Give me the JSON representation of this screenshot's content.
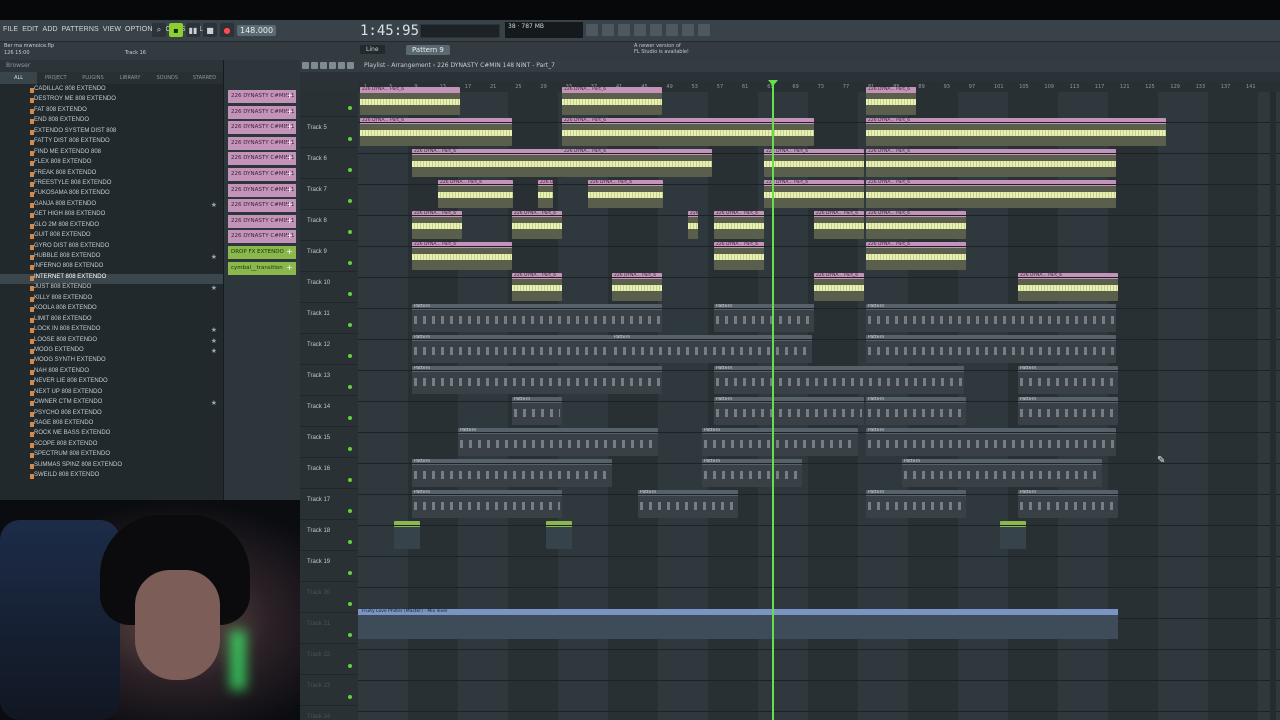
{
  "menu": [
    "FILE",
    "EDIT",
    "ADD",
    "PATTERNS",
    "VIEW",
    "OPTIONS",
    "TOOLS",
    "HELP"
  ],
  "transport": {
    "tempo": "148.000",
    "time": "1:45:95",
    "cpu": "787 MB",
    "voices": "38"
  },
  "hint": {
    "line1": "Ber ma mwnoice.flp",
    "line2": "126 15:00",
    "track": "Track 16"
  },
  "snap": "Line",
  "pattern_selector": "Pattern 9",
  "news": {
    "line1": "A newer version of",
    "line2": "FL Studio is available!"
  },
  "browser": {
    "title": "Browser",
    "tabs": [
      "ALL",
      "PROJECT",
      "PLUGINS",
      "LIBRARY",
      "SOUNDS",
      "STARRED"
    ],
    "items": [
      {
        "label": "CADILLAC 808 EXTENDO",
        "star": ""
      },
      {
        "label": "DESTROY ME 808 EXTENDO",
        "star": ""
      },
      {
        "label": "FAT 808 EXTENDO",
        "star": ""
      },
      {
        "label": "END 808 EXTENDO",
        "star": ""
      },
      {
        "label": "EXTENDO SYSTEM DIST 808",
        "star": ""
      },
      {
        "label": "FATTY DIST 808 EXTENDO",
        "star": ""
      },
      {
        "label": "FIND ME EXTENDO 808",
        "star": ""
      },
      {
        "label": "FLEX 808 EXTENDO",
        "star": ""
      },
      {
        "label": "FREAK 808 EXTENDO",
        "star": ""
      },
      {
        "label": "FREESTYLE 808 EXTENDO",
        "star": ""
      },
      {
        "label": "FUKOSAMA 808 EXTENDO",
        "star": ""
      },
      {
        "label": "GANJA 808 EXTENDO",
        "star": "★"
      },
      {
        "label": "GET HIGH 808 EXTENDO",
        "star": ""
      },
      {
        "label": "GLO 2M 808 EXTENDO",
        "star": ""
      },
      {
        "label": "GUIT 808 EXTENDO",
        "star": ""
      },
      {
        "label": "GYRO DIST 808 EXTENDO",
        "star": ""
      },
      {
        "label": "HUBBLE 808 EXTENDO",
        "star": "★"
      },
      {
        "label": "INFERNO 808 EXTENDO",
        "star": ""
      },
      {
        "label": "INTERNET 808 EXTENDO",
        "star": ""
      },
      {
        "label": "JUST 808 EXTENDO",
        "star": "★"
      },
      {
        "label": "KILLY 808 EXTENDO",
        "star": ""
      },
      {
        "label": "KOOLA 808 EXTENDO",
        "star": ""
      },
      {
        "label": "LIMIT 808 EXTENDO",
        "star": ""
      },
      {
        "label": "LOCK IN 808 EXTENDO",
        "star": "★"
      },
      {
        "label": "LOOSE 808 EXTENDO",
        "star": "★"
      },
      {
        "label": "MOOG EXTENDO",
        "star": "★"
      },
      {
        "label": "MOOG SYNTH EXTENDO",
        "star": ""
      },
      {
        "label": "NAH 808 EXTENDO",
        "star": ""
      },
      {
        "label": "NEVER LIE 808 EXTENDO",
        "star": ""
      },
      {
        "label": "NEXT UP 808 EXTENDO",
        "star": ""
      },
      {
        "label": "OWNER CTM EXTENDO",
        "star": "★"
      },
      {
        "label": "PSYCHO 808 EXTENDO",
        "star": ""
      },
      {
        "label": "RAGE 808 EXTENDO",
        "star": ""
      },
      {
        "label": "ROCK ME BASS EXTENDO",
        "star": ""
      },
      {
        "label": "SCOPE 808 EXTENDO",
        "star": ""
      },
      {
        "label": "SPECTRUM 808 EXTENDO",
        "star": ""
      },
      {
        "label": "SUMMAS SPINZ 808 EXTENDO",
        "star": ""
      },
      {
        "label": "SWEILD 808 EXTENDO",
        "star": ""
      }
    ],
    "selected_index": 18
  },
  "channels": [
    "226 DYNASTY C#MIN 1",
    "226 DYNASTY C#MIN 1",
    "226 DYNASTY C#MIN 1",
    "226 DYNASTY C#MIN 1",
    "226 DYNASTY C#MIN 1",
    "226 DYNASTY C#MIN 1",
    "226 DYNASTY C#MIN 1",
    "226 DYNASTY C#MIN 1",
    "226 DYNASTY C#MIN 1",
    "226 DYNASTY C#MIN 1",
    "DROP FX EXTENDO",
    "cymbal__transition"
  ],
  "playlist": {
    "title": "Playlist - Arrangement › 226 DYNASTY C#MIN 148 NiNT - Part_7",
    "ruler": [
      "1",
      "5",
      "9",
      "13",
      "17",
      "21",
      "25",
      "29",
      "33",
      "37",
      "41",
      "45",
      "49",
      "53",
      "57",
      "61",
      "65",
      "69",
      "73",
      "77",
      "81",
      "85",
      "89",
      "93",
      "97",
      "101",
      "105",
      "109",
      "113",
      "117",
      "121",
      "125",
      "129",
      "133",
      "137",
      "141"
    ],
    "tracks": [
      "",
      "Track 5",
      "Track 6",
      "Track 7",
      "Track 8",
      "Track 9",
      "Track 10",
      "Track 11",
      "Track 12",
      "Track 13",
      "Track 14",
      "Track 15",
      "Track 16",
      "Track 17",
      "Track 18",
      "Track 19",
      "Track 20",
      "Track 21",
      "Track 22",
      "Track 23",
      "Track 24"
    ],
    "automation_label": "Fruity Love Philter (Master) - Mix level"
  }
}
